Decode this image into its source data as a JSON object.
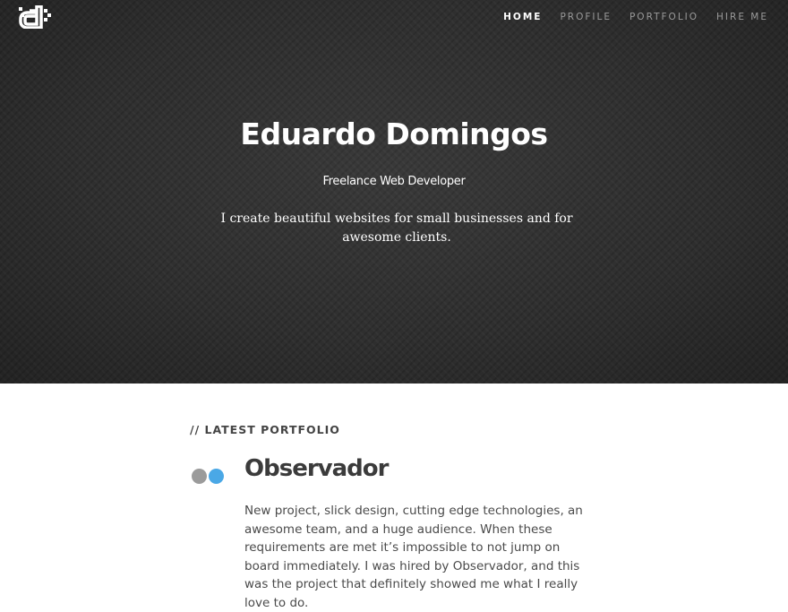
{
  "header": {
    "logo_alt": "d",
    "nav": [
      {
        "label": "HOME",
        "active": true
      },
      {
        "label": "PROFILE",
        "active": false
      },
      {
        "label": "PORTFOLIO",
        "active": false
      },
      {
        "label": "HIRE ME",
        "active": false
      }
    ]
  },
  "hero": {
    "title": "Eduardo Domingos",
    "subtitle": "Freelance Web Developer",
    "tagline": "I create beautiful websites for small businesses and for awesome clients."
  },
  "portfolio": {
    "section_label": "// LATEST PORTFOLIO",
    "project": {
      "title": "Observador",
      "description": "New project, slick design, cutting edge technologies, an awesome team, and a huge audience. When these requirements are met it’s impossible to not jump on board immediately. I was hired by Observador, and this was the project that definitely showed me what I really love to do.",
      "icon": "observador-logo-icon",
      "icon_colors": [
        "#9b9b9b",
        "#4aa8e6"
      ]
    }
  },
  "colors": {
    "hero_background": "#2f2f2f",
    "nav_active": "#ffffff",
    "nav_inactive": "#9a9a9a",
    "text_dark": "#3b3b3b"
  }
}
